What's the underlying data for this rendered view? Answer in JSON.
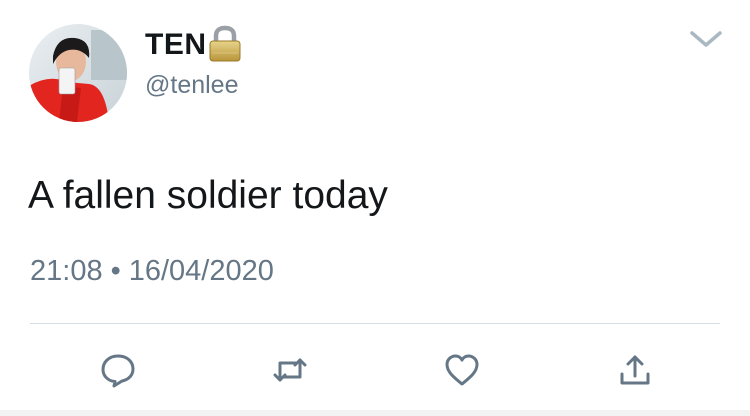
{
  "user": {
    "display_name": "TEN",
    "handle": "@tenlee",
    "avatar_icon": "profile-photo",
    "lock_icon": "lock-icon"
  },
  "tweet": {
    "text": "A fallen soldier today",
    "time": "21:08",
    "separator": "•",
    "date": "16/04/2020"
  },
  "actions": [
    {
      "name": "reply",
      "icon": "comment-bubble-icon"
    },
    {
      "name": "retweet",
      "icon": "retweet-arrows-icon"
    },
    {
      "name": "like",
      "icon": "heart-icon"
    },
    {
      "name": "share",
      "icon": "share-upload-icon"
    }
  ],
  "colors": {
    "text": "#14171a",
    "secondary": "#657786",
    "divider": "#d8dde1",
    "action_icon": "#657786",
    "chevron": "#aab8c2"
  }
}
